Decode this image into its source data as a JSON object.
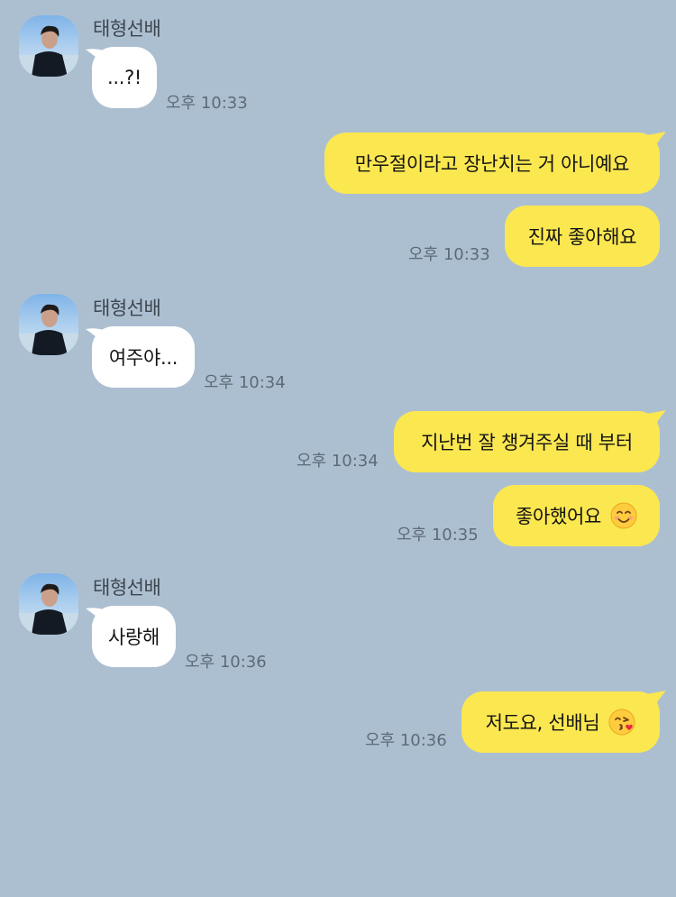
{
  "sender_name": "태형선배",
  "colors": {
    "background": "#acbfd1",
    "incoming_bubble": "#ffffff",
    "outgoing_bubble": "#fbe750"
  },
  "messages": [
    {
      "direction": "in",
      "text": "...?!",
      "time": "오후 10:33"
    },
    {
      "direction": "out",
      "text": "만우절이라고 장난치는 거 아니예요",
      "time": ""
    },
    {
      "direction": "out",
      "text": "진짜 좋아해요",
      "time": "오후 10:33"
    },
    {
      "direction": "in",
      "text": "여주야...",
      "time": "오후 10:34"
    },
    {
      "direction": "out",
      "text": "지난번 잘 챙겨주실 때 부터",
      "time": "오후 10:34"
    },
    {
      "direction": "out",
      "text": "좋아했어요",
      "emoji": "smiling-face-with-smiling-eyes",
      "time": "오후 10:35"
    },
    {
      "direction": "in",
      "text": "사랑해",
      "time": "오후 10:36"
    },
    {
      "direction": "out",
      "text": "저도요, 선배님",
      "emoji": "face-blowing-a-kiss",
      "time": "오후 10:36"
    }
  ]
}
